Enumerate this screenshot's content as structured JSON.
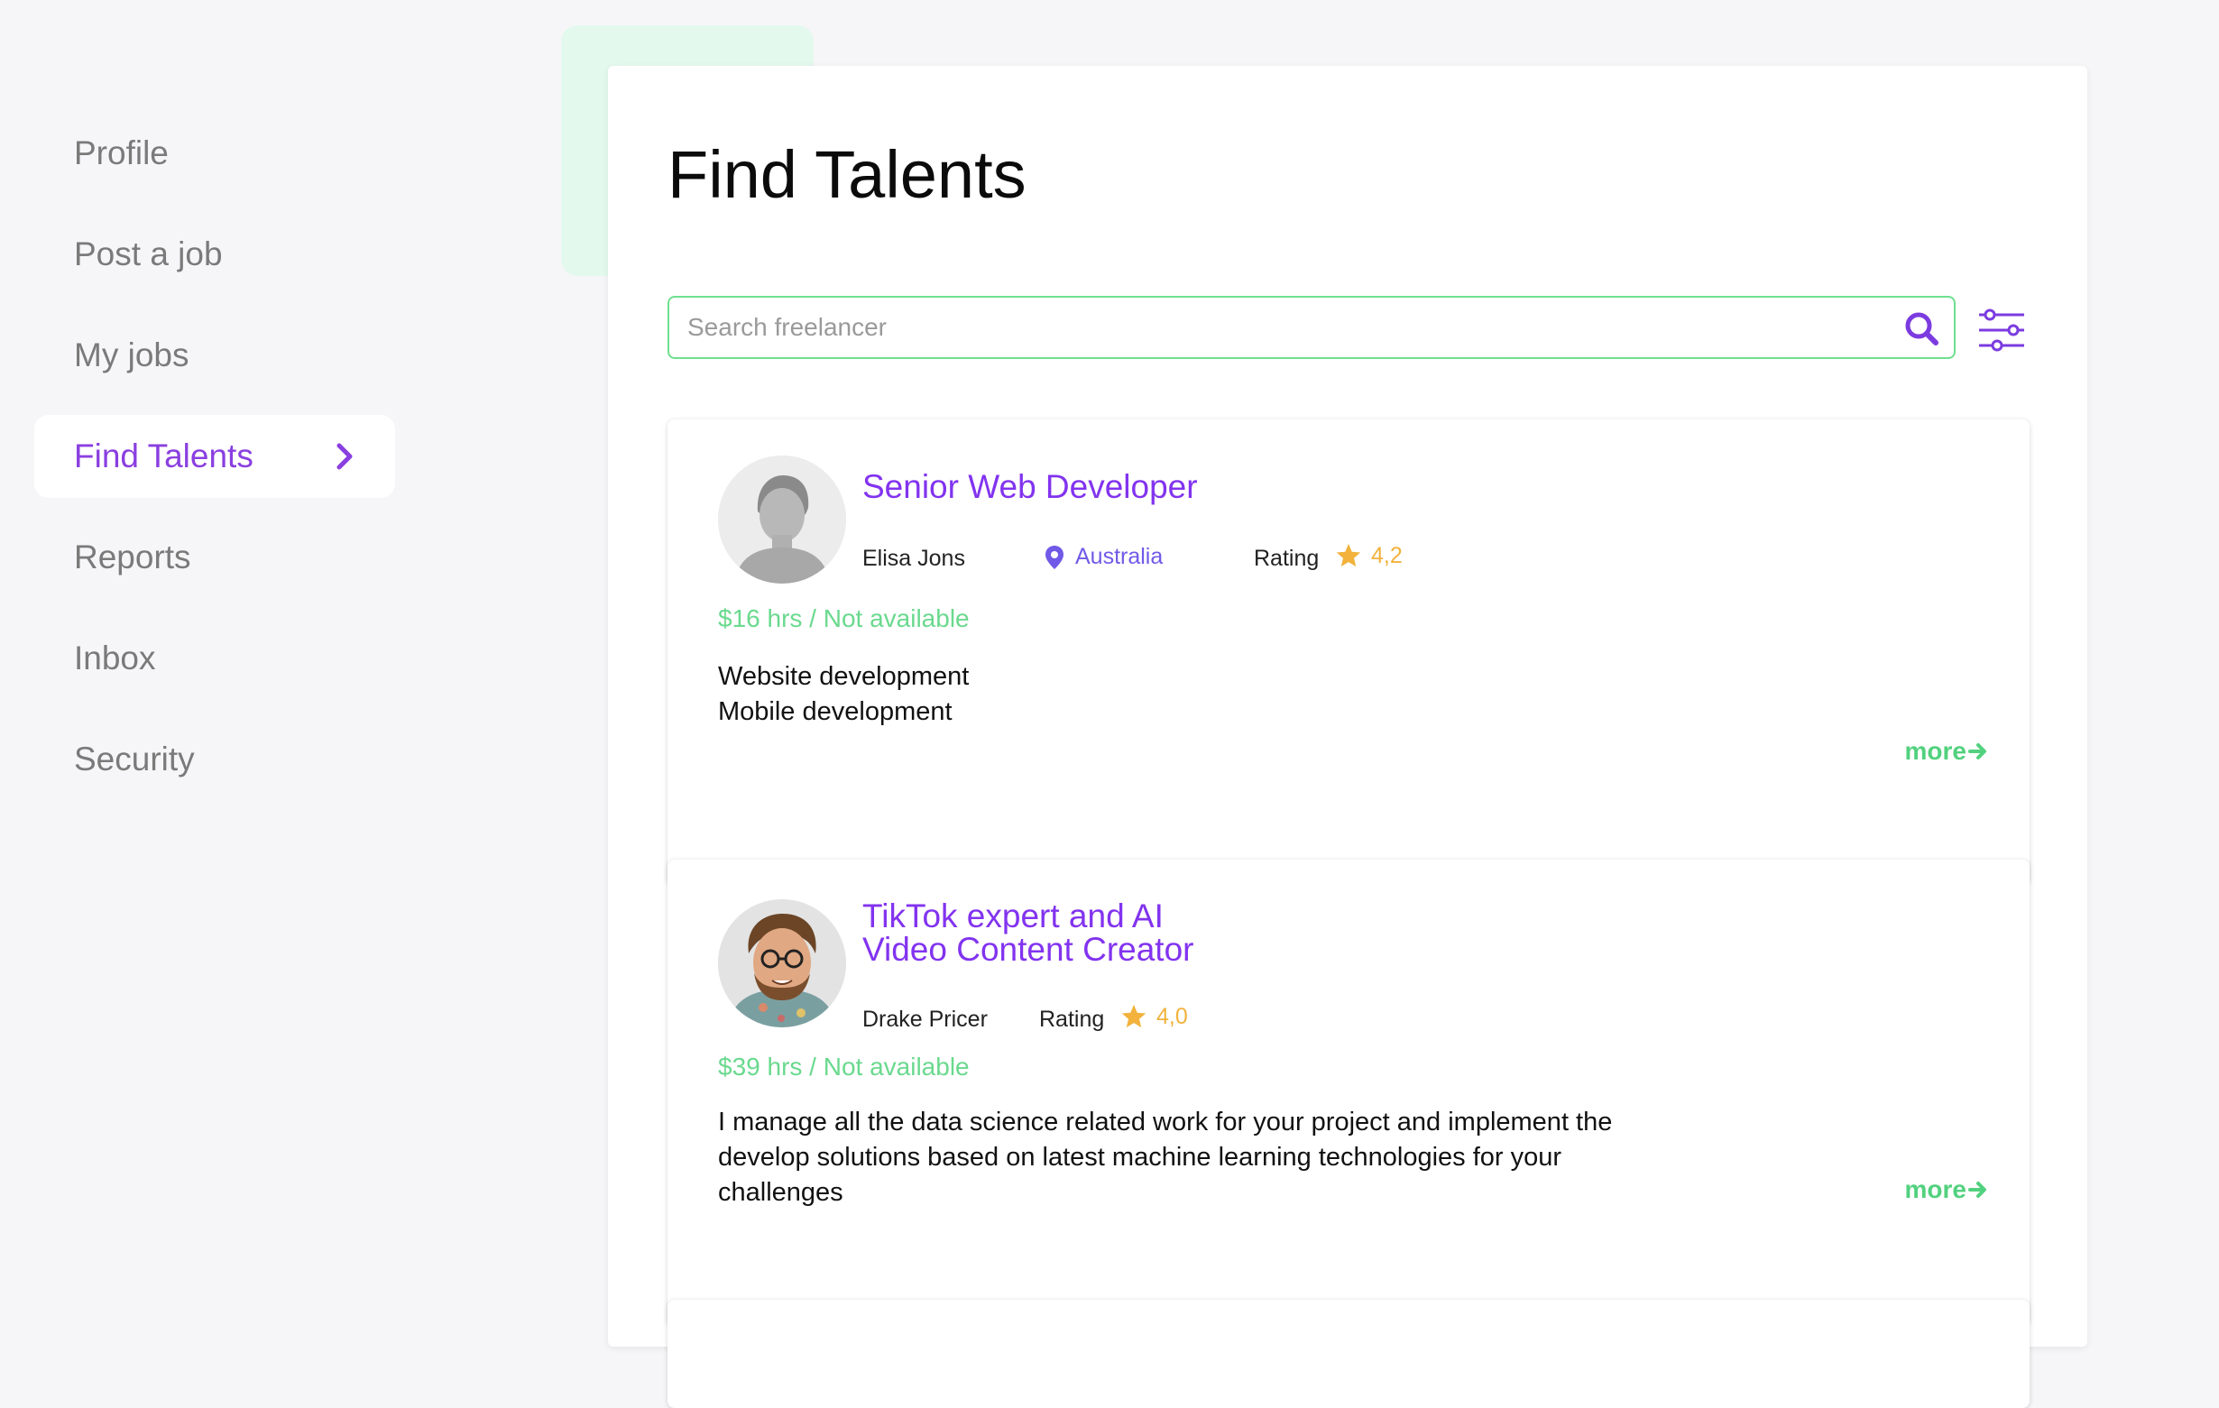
{
  "sidebar": {
    "items": [
      {
        "label": "Profile"
      },
      {
        "label": "Post a job"
      },
      {
        "label": "My jobs"
      },
      {
        "label": "Find Talents"
      },
      {
        "label": "Reports"
      },
      {
        "label": "Inbox"
      },
      {
        "label": "Security"
      }
    ],
    "active_index": 3
  },
  "main": {
    "title": "Find Talents",
    "search": {
      "placeholder": "Search freelancer",
      "value": ""
    },
    "talents": [
      {
        "title": "Senior Web Developer",
        "name": "Elisa Jons",
        "location": "Australia",
        "rating_label": "Rating",
        "rating": "4,2",
        "rate": "$16 hrs / Not available",
        "description_lines": [
          "Website development",
          "Mobile development"
        ],
        "more_label": "more"
      },
      {
        "title": "TikTok expert and AI Video Content Creator",
        "name": "Drake Pricer",
        "rating_label": "Rating",
        "rating": "4,0",
        "rate": "$39 hrs / Not available",
        "description": "I manage all the data science related work for your project and implement the develop solutions based on latest machine learning technologies for your challenges",
        "more_label": "more"
      }
    ]
  },
  "colors": {
    "accent_purple": "#8233ef",
    "accent_green": "#6ee08f",
    "rating_star": "#f2b23c",
    "background": "#f6f6f8"
  },
  "icons": {
    "chevron": "chevron-right-icon",
    "search": "search-icon",
    "filter": "filter-sliders-icon",
    "location": "location-pin-icon",
    "star": "star-icon",
    "arrow": "arrow-right-icon"
  }
}
